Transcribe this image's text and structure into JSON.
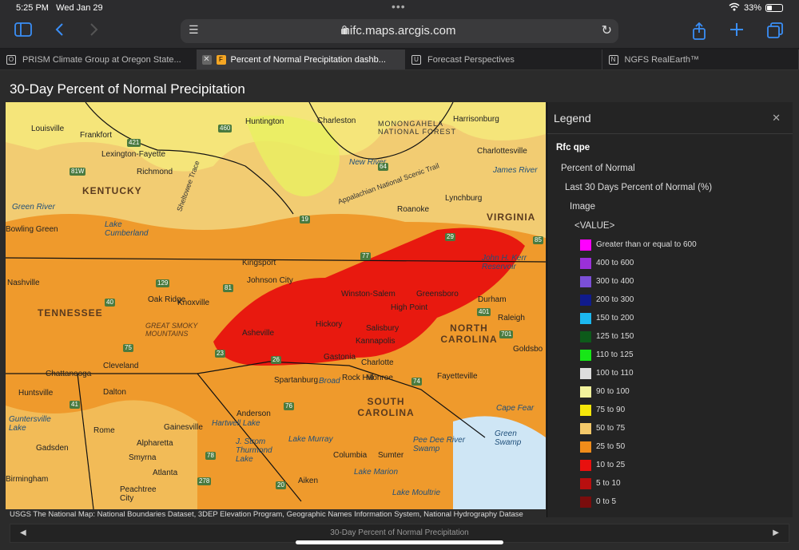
{
  "status_bar": {
    "time": "5:25 PM",
    "date": "Wed Jan 29",
    "battery": "33%",
    "wifi_icon": "wifi-icon"
  },
  "toolbar": {
    "url": "nifc.maps.arcgis.com",
    "sidebar_icon": "sidebar-icon",
    "back_icon": "chevron-left-icon",
    "forward_icon": "chevron-right-icon",
    "share_icon": "share-icon",
    "new_tab_icon": "plus-icon",
    "tabs_icon": "tabs-icon"
  },
  "tabs": [
    {
      "label": "PRISM Climate Group at Oregon State...",
      "fav": "O"
    },
    {
      "label": "Percent of Normal Precipitation dashb...",
      "fav": "F"
    },
    {
      "label": "Forecast Perspectives",
      "fav": "U"
    },
    {
      "label": "NGFS RealEarth™",
      "fav": "N"
    }
  ],
  "page": {
    "title": "30-Day Percent of Normal Precipitation",
    "attribution": "USGS The National Map: National Boundaries Dataset, 3DEP Elevation Program, Geographic Names Information System, National Hydrography Datase",
    "footer": "30-Day Percent of Normal Precipitation"
  },
  "map": {
    "states": [
      "KENTUCKY",
      "VIRGINIA",
      "TENNESSEE",
      "NORTH CAROLINA",
      "SOUTH CAROLINA"
    ],
    "places": [
      "Louisville",
      "Frankfort",
      "Lexington-Fayette",
      "Richmond",
      "Huntington",
      "Charleston",
      "Harrisonburg",
      "Charlottesville",
      "Lynchburg",
      "Roanoke",
      "Kingsport",
      "Johnson City",
      "Knoxville",
      "Oak Ridge",
      "Nashville",
      "Chattanooga",
      "Cleveland",
      "Asheville",
      "Hickory",
      "Winston-Salem",
      "Greensboro",
      "High Point",
      "Durham",
      "Raleigh",
      "Salisbury",
      "Kannapolis",
      "Gastonia",
      "Charlotte",
      "Rock Hill",
      "Monroe",
      "Spartanburg",
      "Anderson",
      "Gainesville",
      "Huntsville",
      "Dalton",
      "Rome",
      "Alpharetta",
      "Smyrna",
      "Atlanta",
      "Gadsden",
      "Birmingham",
      "Peachtree City",
      "Columbia",
      "Sumter",
      "Aiken",
      "Fayetteville",
      "Goldsbo",
      "Bowling Green"
    ],
    "waters": [
      "Green River",
      "Lake Cumberland",
      "Guntersville Lake",
      "Hartwell Lake",
      "J. Strom Thurmond Lake",
      "Lake Murray",
      "Lake Marion",
      "Lake Moultrie",
      "Pee Dee River Swamp",
      "Green Swamp",
      "Cape Fear",
      "John H. Kerr Reservoir",
      "New River",
      "James River",
      "Broad"
    ],
    "labels": [
      "MONONGAHELA NATIONAL FOREST",
      "GREAT SMOKY MOUNTAINS",
      "Appalachian National Scenic Trail",
      "Sheltowee Trace"
    ],
    "roads": [
      "460",
      "421",
      "64",
      "81W",
      "19",
      "77",
      "29",
      "85",
      "129",
      "81",
      "40",
      "75",
      "23",
      "74",
      "26",
      "76",
      "78",
      "278",
      "20",
      "41",
      "701",
      "401"
    ]
  },
  "legend": {
    "title": "Legend",
    "close_icon": "close-icon",
    "layer": "Rfc qpe",
    "sublayer": "Percent of Normal",
    "group": "Last 30 Days Percent of Normal (%)",
    "image": "Image",
    "field": "<VALUE>",
    "items": [
      {
        "label": "Greater than or equal to 600",
        "color": "#ff00ff"
      },
      {
        "label": "400 to 600",
        "color": "#9b30d9"
      },
      {
        "label": "300 to 400",
        "color": "#7b4fd6"
      },
      {
        "label": "200 to 300",
        "color": "#101b8c"
      },
      {
        "label": "150 to 200",
        "color": "#1cb8f0"
      },
      {
        "label": "125 to 150",
        "color": "#0d5a1a"
      },
      {
        "label": "110 to 125",
        "color": "#17e617"
      },
      {
        "label": "100 to 110",
        "color": "#dddddd"
      },
      {
        "label": "90 to 100",
        "color": "#f2f29c"
      },
      {
        "label": "75 to 90",
        "color": "#f5e60a"
      },
      {
        "label": "50 to 75",
        "color": "#f4c96a"
      },
      {
        "label": "25 to 50",
        "color": "#f08c1a"
      },
      {
        "label": "10 to 25",
        "color": "#e8100f"
      },
      {
        "label": "5 to 10",
        "color": "#b80f0f"
      },
      {
        "label": "0 to 5",
        "color": "#7a0d0d"
      }
    ]
  }
}
